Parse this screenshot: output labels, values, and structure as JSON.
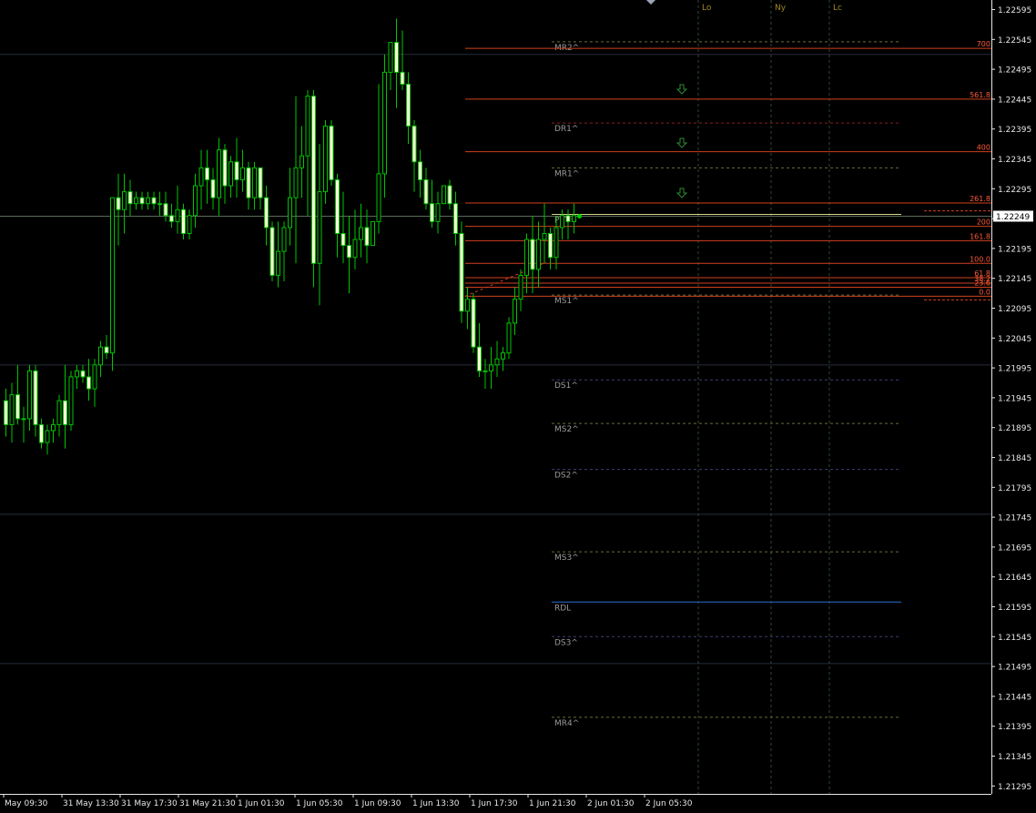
{
  "chart_data": {
    "type": "candlestick",
    "y_ticks": [
      "1.22595",
      "1.22545",
      "1.22495",
      "1.22445",
      "1.22395",
      "1.22345",
      "1.22295",
      "1.22245",
      "1.22195",
      "1.22145",
      "1.22095",
      "1.22045",
      "1.21995",
      "1.21945",
      "1.21895",
      "1.21845",
      "1.21795",
      "1.21745",
      "1.21695",
      "1.21645",
      "1.21595",
      "1.21545",
      "1.21495",
      "1.21445",
      "1.21395",
      "1.21345",
      "1.21295"
    ],
    "x_ticks": [
      "May 09:30",
      "31 May 13:30",
      "31 May 17:30",
      "31 May 21:30",
      "1 Jun 01:30",
      "1 Jun 05:30",
      "1 Jun 09:30",
      "1 Jun 13:30",
      "1 Jun 17:30",
      "1 Jun 21:30",
      "2 Jun 01:30",
      "2 Jun 05:30"
    ],
    "current_price": "1.22249",
    "ylim": [
      1.2127,
      1.2262
    ],
    "candles": [
      [
        1.2194,
        1.2196,
        1.2188,
        1.219
      ],
      [
        1.219,
        1.2197,
        1.2187,
        1.2195
      ],
      [
        1.2195,
        1.22,
        1.219,
        1.2191
      ],
      [
        1.2191,
        1.2193,
        1.2187,
        1.2191
      ],
      [
        1.2191,
        1.22,
        1.2189,
        1.2199
      ],
      [
        1.2199,
        1.22,
        1.2188,
        1.219
      ],
      [
        1.219,
        1.2191,
        1.2186,
        1.2187
      ],
      [
        1.2187,
        1.219,
        1.2185,
        1.2189
      ],
      [
        1.2189,
        1.2191,
        1.2187,
        1.219
      ],
      [
        1.219,
        1.2195,
        1.2188,
        1.2194
      ],
      [
        1.2194,
        1.22,
        1.2186,
        1.219
      ],
      [
        1.219,
        1.2199,
        1.2189,
        1.2198
      ],
      [
        1.2198,
        1.22,
        1.2196,
        1.2199
      ],
      [
        1.2199,
        1.22,
        1.2197,
        1.2198
      ],
      [
        1.2198,
        1.2201,
        1.2194,
        1.2196
      ],
      [
        1.2196,
        1.2201,
        1.2193,
        1.22
      ],
      [
        1.22,
        1.2204,
        1.2198,
        1.2203
      ],
      [
        1.2203,
        1.2205,
        1.2201,
        1.2202
      ],
      [
        1.2202,
        1.2228,
        1.2199,
        1.2228
      ],
      [
        1.2228,
        1.2232,
        1.222,
        1.2226
      ],
      [
        1.2226,
        1.2232,
        1.2222,
        1.2229
      ],
      [
        1.2229,
        1.2231,
        1.2225,
        1.2227
      ],
      [
        1.2227,
        1.2229,
        1.2226,
        1.2228
      ],
      [
        1.2228,
        1.2229,
        1.2226,
        1.2227
      ],
      [
        1.2227,
        1.2229,
        1.2226,
        1.2228
      ],
      [
        1.2228,
        1.2229,
        1.2226,
        1.2227
      ],
      [
        1.2227,
        1.2229,
        1.2225,
        1.2227
      ],
      [
        1.2227,
        1.2229,
        1.2224,
        1.2225
      ],
      [
        1.2225,
        1.2227,
        1.2223,
        1.2224
      ],
      [
        1.2224,
        1.223,
        1.2222,
        1.2226
      ],
      [
        1.2226,
        1.2227,
        1.2221,
        1.2222
      ],
      [
        1.2222,
        1.2226,
        1.2221,
        1.2225
      ],
      [
        1.2225,
        1.2232,
        1.2223,
        1.223
      ],
      [
        1.223,
        1.2236,
        1.2226,
        1.2233
      ],
      [
        1.2233,
        1.2236,
        1.2227,
        1.2231
      ],
      [
        1.2231,
        1.2233,
        1.2226,
        1.2228
      ],
      [
        1.2228,
        1.2238,
        1.2225,
        1.2236
      ],
      [
        1.2236,
        1.2237,
        1.2227,
        1.223
      ],
      [
        1.223,
        1.2235,
        1.2228,
        1.2234
      ],
      [
        1.2234,
        1.2238,
        1.2228,
        1.2231
      ],
      [
        1.2231,
        1.2236,
        1.2229,
        1.2233
      ],
      [
        1.2233,
        1.2234,
        1.2226,
        1.2228
      ],
      [
        1.2228,
        1.2234,
        1.2226,
        1.2233
      ],
      [
        1.2233,
        1.2233,
        1.2226,
        1.2228
      ],
      [
        1.2228,
        1.223,
        1.222,
        1.2223
      ],
      [
        1.2223,
        1.2224,
        1.2214,
        1.2215
      ],
      [
        1.2215,
        1.2224,
        1.2213,
        1.2219
      ],
      [
        1.2219,
        1.2224,
        1.2214,
        1.2223
      ],
      [
        1.2223,
        1.2233,
        1.222,
        1.2228
      ],
      [
        1.2228,
        1.2245,
        1.2217,
        1.2233
      ],
      [
        1.2233,
        1.224,
        1.2228,
        1.2235
      ],
      [
        1.2235,
        1.2246,
        1.2225,
        1.2245
      ],
      [
        1.2245,
        1.2246,
        1.2213,
        1.2217
      ],
      [
        1.2217,
        1.2237,
        1.221,
        1.2229
      ],
      [
        1.2229,
        1.2241,
        1.2227,
        1.224
      ],
      [
        1.224,
        1.2241,
        1.223,
        1.2231
      ],
      [
        1.2231,
        1.2232,
        1.2218,
        1.2222
      ],
      [
        1.2222,
        1.2229,
        1.2217,
        1.222
      ],
      [
        1.222,
        1.2225,
        1.2212,
        1.2218
      ],
      [
        1.2218,
        1.2226,
        1.2216,
        1.2221
      ],
      [
        1.2221,
        1.2227,
        1.2218,
        1.2223
      ],
      [
        1.2223,
        1.2226,
        1.2217,
        1.222
      ],
      [
        1.222,
        1.2224,
        1.222,
        1.2224
      ],
      [
        1.2224,
        1.2247,
        1.2222,
        1.2232
      ],
      [
        1.2232,
        1.2252,
        1.2228,
        1.2249
      ],
      [
        1.2249,
        1.2254,
        1.2246,
        1.2254
      ],
      [
        1.2254,
        1.2258,
        1.2243,
        1.2249
      ],
      [
        1.2249,
        1.2256,
        1.2246,
        1.2247
      ],
      [
        1.2247,
        1.2249,
        1.2237,
        1.224
      ],
      [
        1.224,
        1.2241,
        1.2229,
        1.2234
      ],
      [
        1.2234,
        1.2236,
        1.2228,
        1.2231
      ],
      [
        1.2231,
        1.2233,
        1.2226,
        1.2227
      ],
      [
        1.2227,
        1.2231,
        1.2223,
        1.2224
      ],
      [
        1.2224,
        1.2229,
        1.2222,
        1.2227
      ],
      [
        1.2227,
        1.223,
        1.2227,
        1.223
      ],
      [
        1.223,
        1.2231,
        1.2226,
        1.2227
      ],
      [
        1.2227,
        1.2229,
        1.222,
        1.2222
      ],
      [
        1.2222,
        1.2224,
        1.2207,
        1.2209
      ],
      [
        1.2209,
        1.2213,
        1.2206,
        1.2211
      ],
      [
        1.2211,
        1.2212,
        1.2202,
        1.2203
      ],
      [
        1.2203,
        1.2207,
        1.2198,
        1.2199
      ],
      [
        1.2199,
        1.2201,
        1.2196,
        1.2199
      ],
      [
        1.2199,
        1.2203,
        1.2196,
        1.22
      ],
      [
        1.22,
        1.2204,
        1.2198,
        1.2201
      ],
      [
        1.2201,
        1.2203,
        1.2199,
        1.2202
      ],
      [
        1.2202,
        1.2208,
        1.2201,
        1.2207
      ],
      [
        1.2207,
        1.2213,
        1.2205,
        1.2211
      ],
      [
        1.2211,
        1.2216,
        1.2209,
        1.2215
      ],
      [
        1.2215,
        1.2222,
        1.2212,
        1.2221
      ],
      [
        1.2221,
        1.2225,
        1.2212,
        1.2216
      ],
      [
        1.2216,
        1.2224,
        1.2213,
        1.2221
      ],
      [
        1.2221,
        1.2227,
        1.2217,
        1.2222
      ],
      [
        1.2222,
        1.2223,
        1.2216,
        1.2218
      ],
      [
        1.2218,
        1.2225,
        1.2216,
        1.2223
      ],
      [
        1.2223,
        1.2226,
        1.2221,
        1.2225
      ],
      [
        1.2225,
        1.2226,
        1.2221,
        1.2224
      ],
      [
        1.2224,
        1.2227,
        1.2222,
        1.2225
      ]
    ],
    "horizontal_grid": [
      1.2252,
      1.22,
      1.2175,
      1.215
    ],
    "pivot_levels": [
      {
        "label": "MR2^",
        "price": 1.22541,
        "style": "dash",
        "color": "#6b6b3a"
      },
      {
        "label": "DR1^",
        "price": 1.22405,
        "style": "dash",
        "color": "#8a1e1e"
      },
      {
        "label": "MR1^",
        "price": 1.2233,
        "style": "dash",
        "color": "#6b6b3a"
      },
      {
        "label": "PVT^",
        "price": 1.22252,
        "style": "solid",
        "color": "#d6d68a"
      },
      {
        "label": "MS1^",
        "price": 1.22117,
        "style": "dash",
        "color": "#6b6b3a"
      },
      {
        "label": "DS1^",
        "price": 1.21975,
        "style": "dash",
        "color": "#3e3e72"
      },
      {
        "label": "MS2^",
        "price": 1.21902,
        "style": "dash",
        "color": "#6b6b3a"
      },
      {
        "label": "DS2^",
        "price": 1.21825,
        "style": "dash",
        "color": "#3e3e72"
      },
      {
        "label": "MS3^",
        "price": 1.21687,
        "style": "dash",
        "color": "#6b6b3a"
      },
      {
        "label": "RDL",
        "price": 1.21603,
        "style": "solid",
        "color": "#2a6fd6"
      },
      {
        "label": "DS3^",
        "price": 1.21545,
        "style": "dash",
        "color": "#3e3e72"
      },
      {
        "label": "MR4^",
        "price": 1.2141,
        "style": "dash",
        "color": "#6b6b3a"
      }
    ],
    "fib_levels": [
      {
        "label": "700",
        "price": 1.2253
      },
      {
        "label": "561.8",
        "price": 1.22445
      },
      {
        "label": "400",
        "price": 1.22357
      },
      {
        "label": "261.8",
        "price": 1.22271
      },
      {
        "label": "200",
        "price": 1.22232
      },
      {
        "label": "161.8",
        "price": 1.22208
      },
      {
        "label": "100.0",
        "price": 1.2217
      },
      {
        "label": "61.8",
        "price": 1.22146
      },
      {
        "label": "38.2",
        "price": 1.22137
      },
      {
        "label": "23.6",
        "price": 1.2213
      },
      {
        "label": "0.0",
        "price": 1.22115
      }
    ],
    "sessions": [
      "Lo",
      "Ny",
      "Lc"
    ],
    "colors": {
      "candle": "#00c400",
      "bull_body": "#000000",
      "bear_body": "#ffffd8",
      "fib": "#d0401e",
      "fib_text": "#ff5a3a",
      "pivot_text": "#9a9a9a",
      "axis_text": "#e6e6e6",
      "session_line": "#2e4a2e",
      "session_text": "#a08a1e",
      "grid": "#262c3c",
      "arrow": "#2e8a2e"
    }
  }
}
